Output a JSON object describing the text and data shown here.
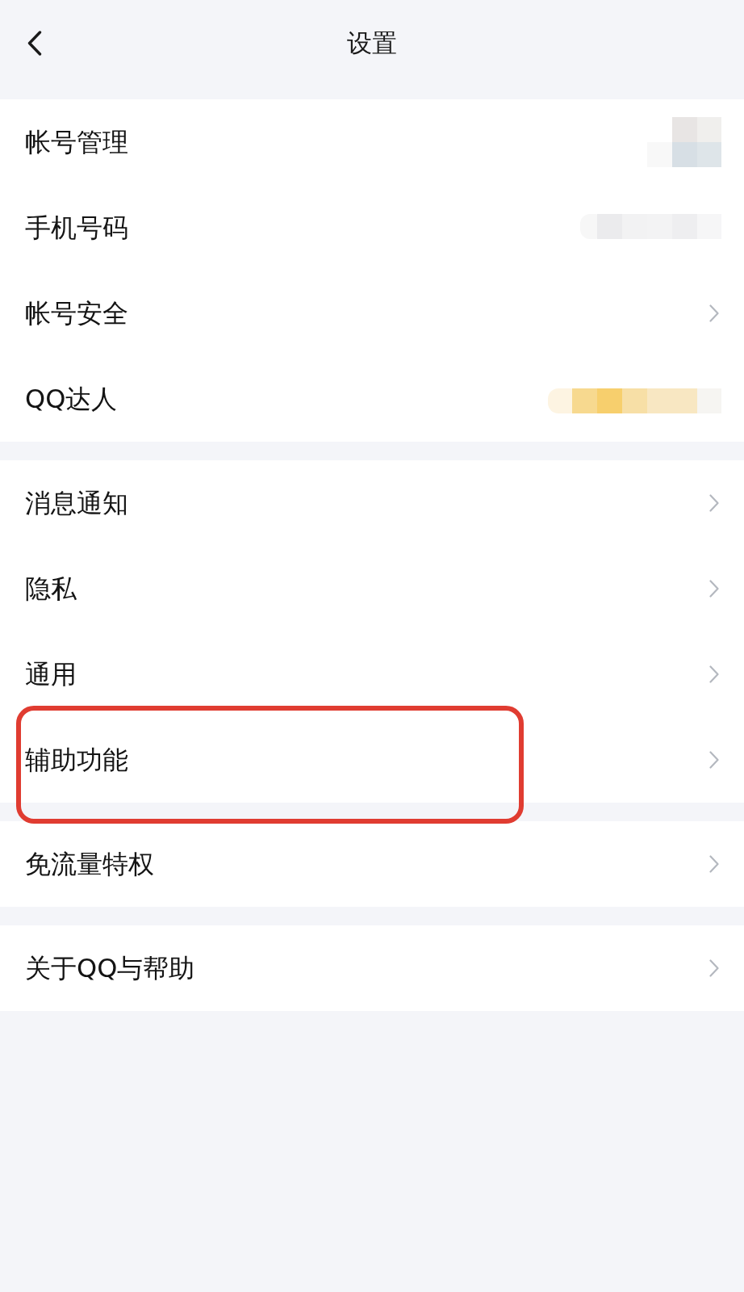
{
  "header": {
    "title": "设置"
  },
  "groups": [
    {
      "items": [
        {
          "label": "帐号管理",
          "kind": "avatar",
          "annotated": false
        },
        {
          "label": "手机号码",
          "kind": "phone",
          "annotated": false
        },
        {
          "label": "帐号安全",
          "kind": "chevron",
          "annotated": false
        },
        {
          "label": "QQ达人",
          "kind": "badge",
          "annotated": false
        }
      ]
    },
    {
      "items": [
        {
          "label": "消息通知",
          "kind": "chevron",
          "annotated": false
        },
        {
          "label": "隐私",
          "kind": "chevron",
          "annotated": false
        },
        {
          "label": "通用",
          "kind": "chevron",
          "annotated": false
        },
        {
          "label": "辅助功能",
          "kind": "chevron",
          "annotated": true
        }
      ]
    },
    {
      "items": [
        {
          "label": "免流量特权",
          "kind": "chevron",
          "annotated": false
        }
      ]
    },
    {
      "items": [
        {
          "label": "关于QQ与帮助",
          "kind": "chevron",
          "annotated": false
        }
      ]
    }
  ]
}
